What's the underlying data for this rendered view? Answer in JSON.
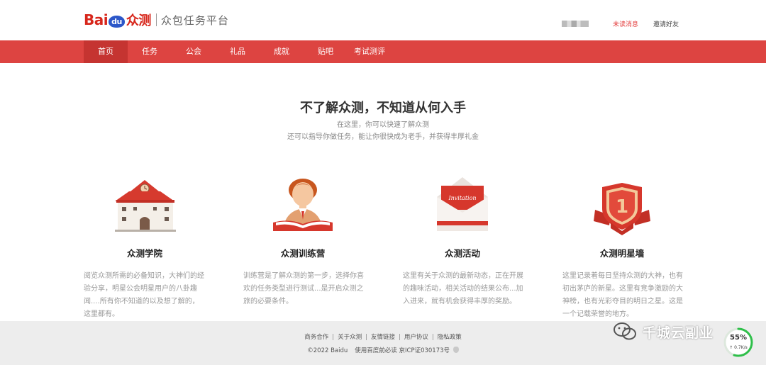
{
  "header": {
    "logo": {
      "bai": "Bai",
      "du": "du",
      "zc": "众测"
    },
    "platform": "众包任务平台",
    "unread": "未读消息",
    "invite": "邀请好友"
  },
  "nav": {
    "items": [
      {
        "label": "首页",
        "active": true
      },
      {
        "label": "任务"
      },
      {
        "label": "公会"
      },
      {
        "label": "礼品"
      },
      {
        "label": "成就"
      },
      {
        "label": "贴吧"
      },
      {
        "label": "考试测评"
      }
    ]
  },
  "hero": {
    "title": "不了解众测，不知道从何入手",
    "line1": "在这里，你可以快速了解众测",
    "line2": "还可以指导你做任务，能让你很快成为老手，并获得丰厚礼金"
  },
  "features": [
    {
      "icon": "school-building-icon",
      "title": "众测学院",
      "desc": "阅览众测所需的必备知识，大神们的经验分享，明星公会明星用户的八卦趣闻....所有你不知道的以及想了解的，这里都有。"
    },
    {
      "icon": "teacher-reading-icon",
      "title": "众测训练营",
      "desc": "训练营是了解众测的第一步，选择你喜欢的任务类型进行测试...是开启众测之旅的必要条件。"
    },
    {
      "icon": "invitation-envelope-icon",
      "title": "众测活动",
      "invitation_word": "Invitation",
      "desc": "这里有关于众测的最新动态，正在开展的趣味活动，相关活动的结果公布...加入进来，就有机会获得丰厚的奖励。"
    },
    {
      "icon": "number-one-medal-icon",
      "title": "众测明星墙",
      "medal_number": "1",
      "desc": "这里记录着每日坚持众测的大神，也有初出茅庐的新星。这里有竞争激励的大神榜，也有光彩夺目的明日之星。这是一个记载荣誉的地方。"
    }
  ],
  "footer": {
    "links": [
      "商务合作",
      "关于众测",
      "友情链接",
      "用户协议",
      "隐私政策"
    ],
    "copyright": "©2022 Baidu",
    "must_read": "使用百度前必读",
    "icp": "京ICP证030173号"
  },
  "watermark": {
    "text": "千城云副业"
  },
  "speed_widget": {
    "percent": "55%",
    "rate": "↑ 0.7K/s",
    "level": 0.55
  },
  "colors": {
    "brand_red": "#dd4441",
    "nav_active": "#c53431",
    "baidu_blue": "#2c57c9"
  }
}
